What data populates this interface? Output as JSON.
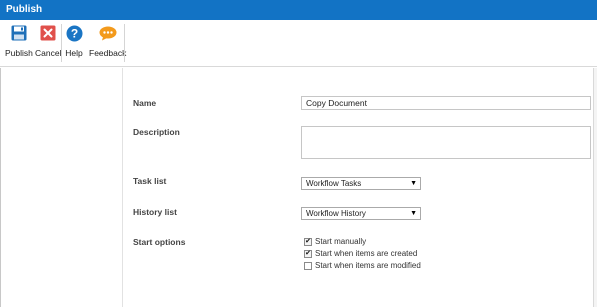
{
  "window": {
    "title": "Publish"
  },
  "ribbon": {
    "publish_label": "Publish",
    "cancel_label": "Cancel",
    "help_label": "Help",
    "feedback_label": "Feedback",
    "icons": {
      "publish": "save-icon",
      "cancel": "close-icon",
      "help": "help-icon",
      "feedback": "feedback-icon"
    },
    "colors": {
      "publish": "#1e6fb8",
      "cancel": "#e0504b",
      "help": "#1a75c4",
      "feedback": "#f39a1c"
    }
  },
  "form": {
    "name": {
      "label": "Name",
      "value": "Copy Document"
    },
    "description": {
      "label": "Description",
      "value": ""
    },
    "task_list": {
      "label": "Task list",
      "value": "Workflow Tasks"
    },
    "history_list": {
      "label": "History list",
      "value": "Workflow History"
    },
    "start_options": {
      "label": "Start options",
      "options": [
        {
          "label": "Start manually",
          "checked": true
        },
        {
          "label": "Start when items are created",
          "checked": true
        },
        {
          "label": "Start when items are modified",
          "checked": false
        }
      ]
    }
  },
  "colors": {
    "titlebar": "#1273c5"
  }
}
